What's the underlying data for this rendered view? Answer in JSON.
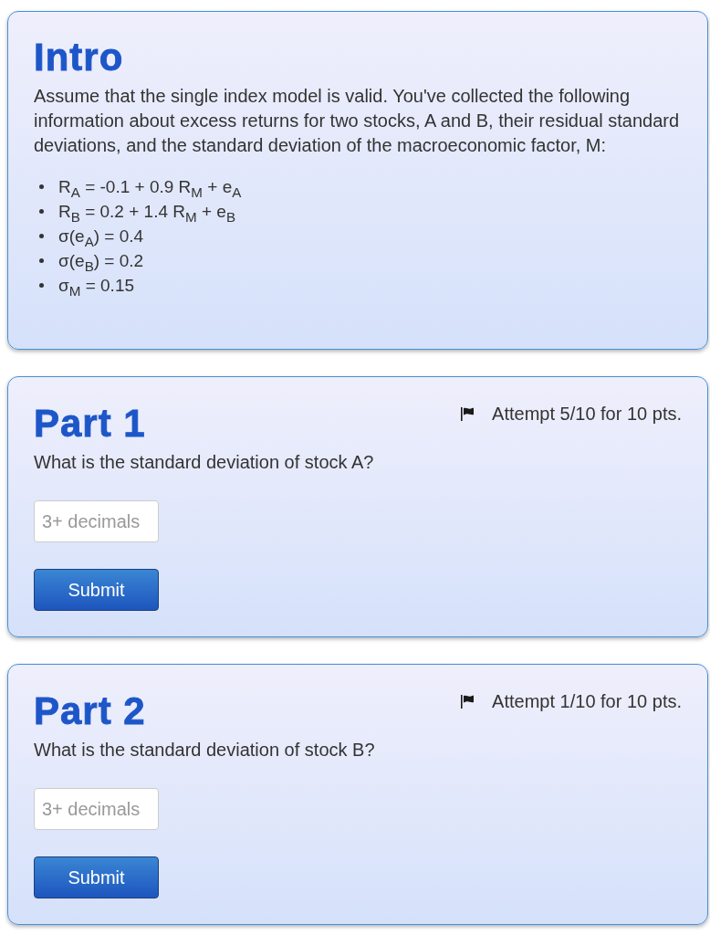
{
  "intro": {
    "title": "Intro",
    "paragraph": "Assume that the single index model is valid. You've collected the following information about excess returns for two stocks, A and B, their residual standard deviations, and the standard deviation of the macroeconomic factor, M:",
    "items": [
      "R$_{A}$ = -0.1 + 0.9 R$_{M}$ + e$_{A}$",
      "R$_{B}$ = 0.2 + 1.4 R$_{M}$ + e$_{B}$",
      "σ(e$_{A}$) = 0.4",
      "σ(e$_{B}$) = 0.2",
      "σ$_{M}$ = 0.15"
    ]
  },
  "parts": [
    {
      "title": "Part 1",
      "attempt": "Attempt 5/10 for 10 pts.",
      "question": "What is the standard deviation of stock A?",
      "answer": {
        "placeholder": "3+ decimals"
      },
      "button": "Submit"
    },
    {
      "title": "Part 2",
      "attempt": "Attempt 1/10 for 10 pts.",
      "question": "What is the standard deviation of stock B?",
      "answer": {
        "placeholder": "3+ decimals"
      },
      "button": "Submit"
    }
  ]
}
